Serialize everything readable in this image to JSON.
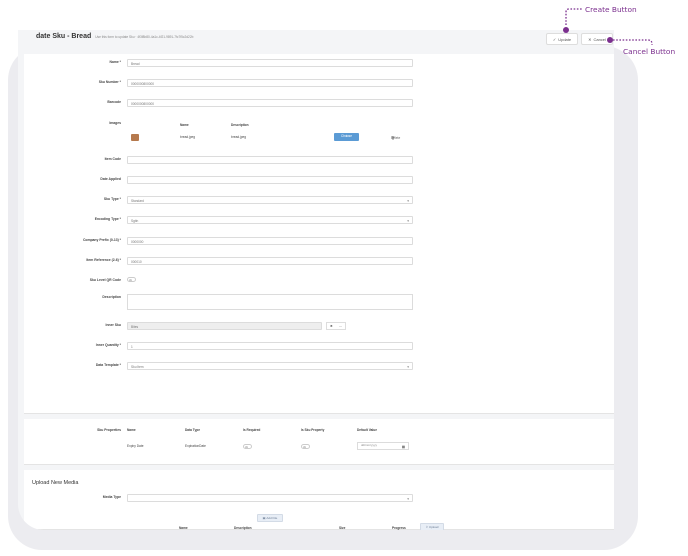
{
  "header": {
    "title": "date Sku - Bread",
    "subtitle": "Use this form to update Sku · 4f3f8b80-4a1c-4f21-9891-7fc7f5c2d22b",
    "update_label": "Update",
    "cancel_label": "Cancel"
  },
  "form": {
    "name_label": "Name *",
    "name_value": "Bread",
    "sku_number_label": "Sku Number *",
    "sku_number_value": "0000000800000",
    "barcode_label": "Barcode",
    "barcode_value": "0000000800000",
    "images_label": "Images",
    "images_columns": [
      "Name",
      "Description"
    ],
    "image_row": {
      "name": "bread.jpeg",
      "description": "bread.jpeg",
      "choose_label": "Choose",
      "delete_label": "Delete"
    },
    "item_code_label": "Item Code",
    "item_code_value": "",
    "date_applied_label": "Date Applied",
    "date_applied_value": "",
    "sku_type_label": "Sku Type *",
    "sku_type_value": "Standard",
    "encoding_type_label": "Encoding Type *",
    "encoding_type_value": "Sgtin",
    "company_prefix_label": "Company Prefix (0-13) *",
    "company_prefix_value": "0000000",
    "item_reference_label": "Item Reference (2-6) *",
    "item_reference_value": "000010",
    "sku_level_qr_label": "Sku Level QR Code",
    "description_label": "Description",
    "inner_sku_label": "Inner Sku",
    "inner_sku_value": "Bites",
    "inner_quantity_label": "Inner Quantity *",
    "inner_quantity_value": "1",
    "data_template_label": "Data Template *",
    "data_template_value": "Sku Item"
  },
  "sku_properties": {
    "section_label": "Sku Properties",
    "columns": [
      "Name",
      "Data Type",
      "Is Required",
      "Is Sku Property",
      "Default Value"
    ],
    "rows": [
      {
        "name": "Expiry Date",
        "data_type": "ExpirationDate",
        "default_placeholder": "dd/mm/yyyy"
      }
    ]
  },
  "media": {
    "section_title": "Upload New Media",
    "media_type_label": "Media Type",
    "media_type_value": "",
    "add_file_label": "Add File",
    "columns": [
      "Name",
      "Description",
      "Size",
      "Progress"
    ],
    "upload_label": "Upload"
  },
  "annotations": {
    "create_button": "Create Button",
    "cancel_button": "Cancel Button"
  },
  "colors": {
    "annotation": "#7b2f8e",
    "primary": "#5b9bd5"
  }
}
